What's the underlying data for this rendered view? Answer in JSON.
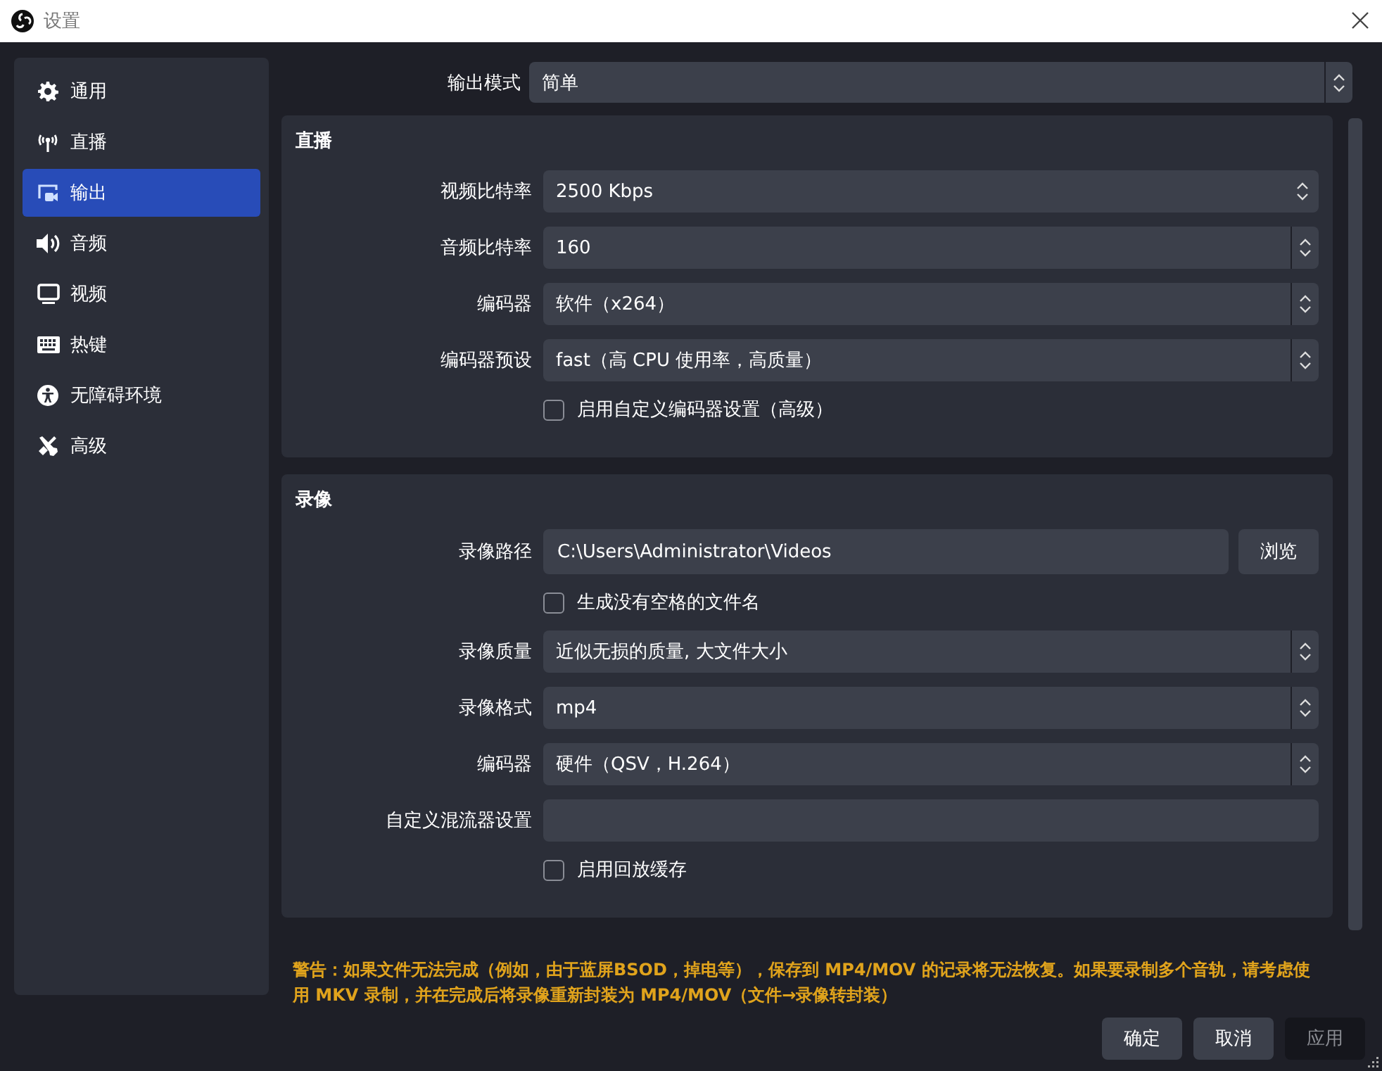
{
  "window": {
    "title": "设置"
  },
  "sidebar": {
    "items": [
      {
        "label": "通用",
        "selected": false
      },
      {
        "label": "直播",
        "selected": false
      },
      {
        "label": "输出",
        "selected": true
      },
      {
        "label": "音频",
        "selected": false
      },
      {
        "label": "视频",
        "selected": false
      },
      {
        "label": "热键",
        "selected": false
      },
      {
        "label": "无障碍环境",
        "selected": false
      },
      {
        "label": "高级",
        "selected": false
      }
    ]
  },
  "output_mode": {
    "label": "输出模式",
    "value": "简单"
  },
  "groups": [
    {
      "title": "直播",
      "rows": [
        {
          "kind": "spin",
          "label": "视频比特率",
          "value": "2500 Kbps"
        },
        {
          "kind": "combo",
          "label": "音频比特率",
          "value": "160"
        },
        {
          "kind": "combo",
          "label": "编码器",
          "value": "软件（x264）"
        },
        {
          "kind": "combo",
          "label": "编码器预设",
          "value": "fast（高 CPU 使用率，高质量）"
        },
        {
          "kind": "checkbox",
          "label": "启用自定义编码器设置（高级）",
          "checked": false
        }
      ]
    },
    {
      "title": "录像",
      "rows": [
        {
          "kind": "path",
          "label": "录像路径",
          "value": "C:\\Users\\Administrator\\Videos",
          "button": "浏览"
        },
        {
          "kind": "checkbox",
          "label": "生成没有空格的文件名",
          "checked": false
        },
        {
          "kind": "combo",
          "label": "录像质量",
          "value": "近似无损的质量, 大文件大小"
        },
        {
          "kind": "combo",
          "label": "录像格式",
          "value": "mp4"
        },
        {
          "kind": "combo",
          "label": "编码器",
          "value": "硬件（QSV，H.264）"
        },
        {
          "kind": "text",
          "label": "自定义混流器设置"
        },
        {
          "kind": "checkbox",
          "label": "启用回放缓存",
          "checked": false
        }
      ]
    }
  ],
  "warning": "警告：如果文件无法完成（例如，由于蓝屏BSOD，掉电等），保存到 MP4/MOV 的记录将无法恢复。如果要录制多个音轨，请考虑使用 MKV 录制，并在完成后将录像重新封装为 MP4/MOV（文件→录像转封装）",
  "buttons": [
    {
      "label": "确定",
      "disabled": false
    },
    {
      "label": "取消",
      "disabled": false
    },
    {
      "label": "应用",
      "disabled": true
    }
  ]
}
